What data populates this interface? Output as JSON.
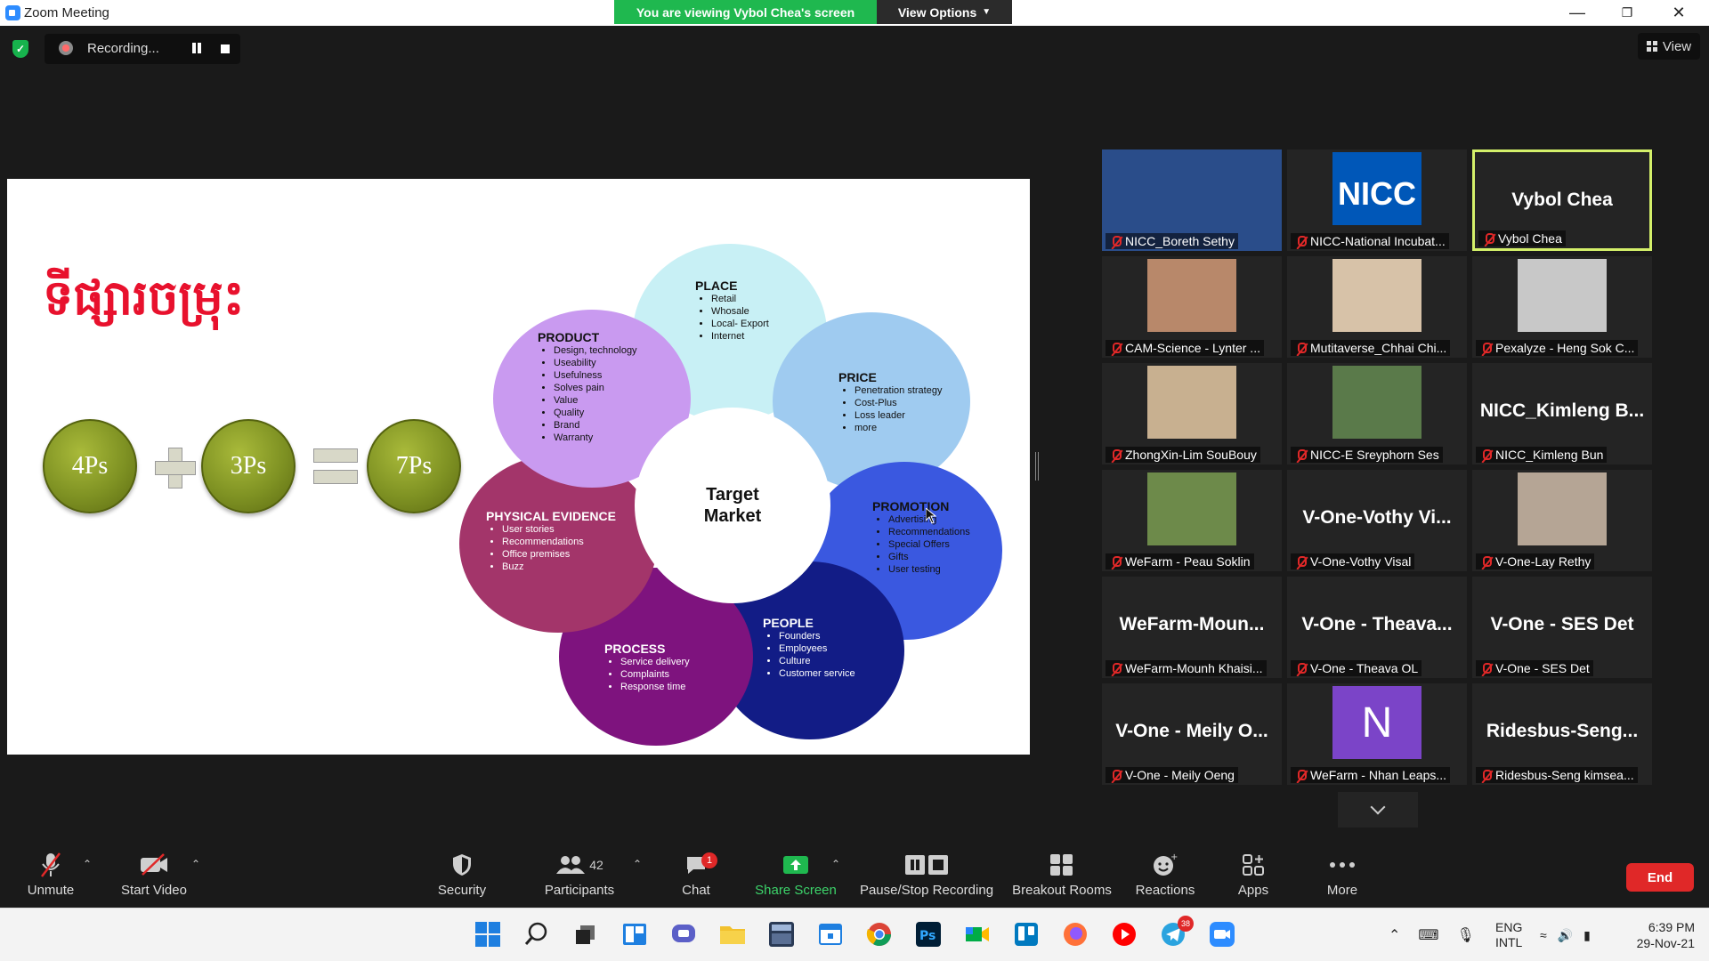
{
  "window": {
    "title": "Zoom Meeting"
  },
  "share_banner": {
    "viewing": "You are viewing Vybol Chea's screen",
    "view_options": "View Options"
  },
  "recording": {
    "label": "Recording..."
  },
  "view": {
    "label": "View"
  },
  "slide": {
    "title": "ទីផ្សារចម្រុះ",
    "ps": [
      "4Ps",
      "3Ps",
      "7Ps"
    ],
    "center": {
      "line1": "Target",
      "line2": "Market"
    },
    "petals": {
      "place": {
        "title": "PLACE",
        "items": [
          "Retail",
          "Whosale",
          "Local- Export",
          "Internet"
        ],
        "color": "#c8f0f5"
      },
      "price": {
        "title": "PRICE",
        "items": [
          "Penetration strategy",
          "Cost-Plus",
          "Loss leader",
          "more"
        ],
        "color": "#9fcbf0"
      },
      "promotion": {
        "title": "PROMOTION",
        "items": [
          "Advertising",
          "Recommendations",
          "Special Offers",
          "Gifts",
          "User testing"
        ],
        "color": "#3a58e0"
      },
      "people": {
        "title": "PEOPLE",
        "items": [
          "Founders",
          "Employees",
          "Culture",
          "Customer service"
        ],
        "color": "#121c86"
      },
      "process": {
        "title": "PROCESS",
        "items": [
          "Service delivery",
          "Complaints",
          "Response time"
        ],
        "color": "#7e137e"
      },
      "physical": {
        "title": "PHYSICAL EVIDENCE",
        "items": [
          "User stories",
          "Recommendations",
          "Office premises",
          "Buzz"
        ],
        "color": "#a3356a"
      },
      "product": {
        "title": "PRODUCT",
        "items": [
          "Design, technology",
          "Useability",
          "Usefulness",
          "Solves pain",
          "Value",
          "Quality",
          "Brand",
          "Warranty"
        ],
        "color": "#c99af0"
      }
    }
  },
  "gallery": [
    {
      "label": "NICC_Boreth Sethy",
      "big": "",
      "video": true
    },
    {
      "label": "NICC-National Incubat...",
      "big": "NICC",
      "video": true
    },
    {
      "label": "Vybol Chea",
      "big": "Vybol Chea",
      "video": false,
      "active": true
    },
    {
      "label": "CAM-Science - Lynter ...",
      "big": "",
      "video": true
    },
    {
      "label": "Mutitaverse_Chhai Chi...",
      "big": "",
      "video": true
    },
    {
      "label": "Pexalyze - Heng Sok C...",
      "big": "",
      "video": true
    },
    {
      "label": "ZhongXin-Lim SouBouy",
      "big": "",
      "video": true
    },
    {
      "label": "NICC-E Sreyphorn Ses",
      "big": "",
      "video": true
    },
    {
      "label": "NICC_Kimleng Bun",
      "big": "NICC_Kimleng B...",
      "video": false
    },
    {
      "label": "WeFarm - Peau Soklin",
      "big": "",
      "video": true
    },
    {
      "label": "V-One-Vothy Visal",
      "big": "V-One-Vothy Vi...",
      "video": false
    },
    {
      "label": "V-One-Lay Rethy",
      "big": "",
      "video": true
    },
    {
      "label": "WeFarm-Mounh Khaisi...",
      "big": "WeFarm-Moun...",
      "video": false
    },
    {
      "label": "V-One - Theava OL",
      "big": "V-One - Theava...",
      "video": false
    },
    {
      "label": "V-One - SES Det",
      "big": "V-One - SES Det",
      "video": false
    },
    {
      "label": "V-One - Meily Oeng",
      "big": "V-One - Meily O...",
      "video": false
    },
    {
      "label": "WeFarm - Nhan Leaps...",
      "big": "N",
      "video": false
    },
    {
      "label": "Ridesbus-Seng kimsea...",
      "big": "Ridesbus-Seng...",
      "video": false
    }
  ],
  "toolbar": {
    "unmute": "Unmute",
    "start_video": "Start Video",
    "security": "Security",
    "participants": "Participants",
    "participants_count": "42",
    "chat": "Chat",
    "chat_badge": "1",
    "share_screen": "Share Screen",
    "pause_recording": "Pause/Stop Recording",
    "breakout": "Breakout Rooms",
    "reactions": "Reactions",
    "apps": "Apps",
    "more": "More",
    "end": "End"
  },
  "taskbar": {
    "lang1": "ENG",
    "lang2": "INTL",
    "time": "6:39 PM",
    "date": "29-Nov-21",
    "telegram_badge": "38"
  },
  "colors": {
    "accent_green": "#1fb84f",
    "end_red": "#e02828",
    "active_border": "#d4f06a"
  }
}
